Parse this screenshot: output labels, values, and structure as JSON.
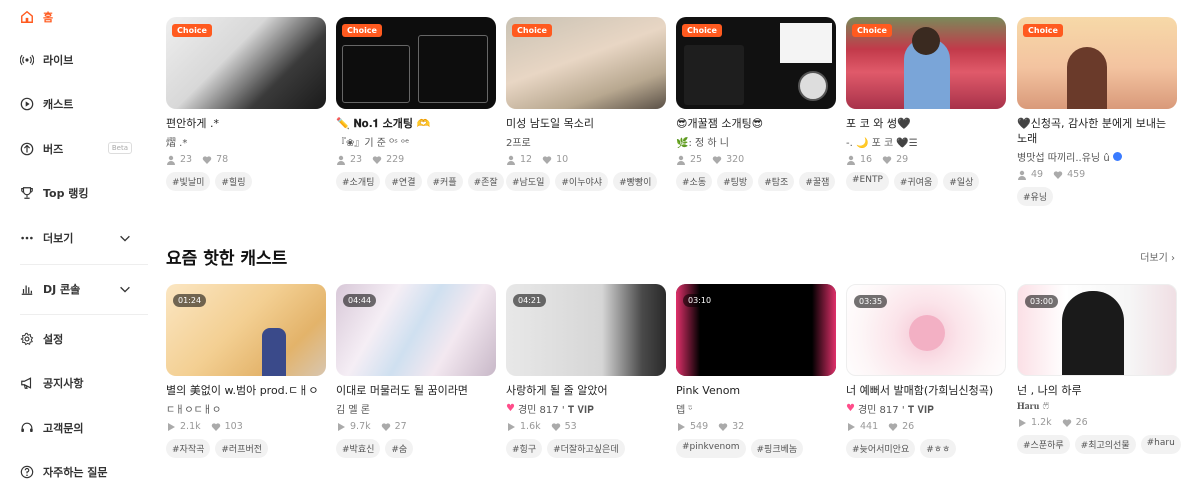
{
  "sidebar": {
    "items": [
      {
        "label": "홈",
        "icon": "home-icon"
      },
      {
        "label": "라이브",
        "icon": "live-icon"
      },
      {
        "label": "캐스트",
        "icon": "cast-icon"
      },
      {
        "label": "버즈",
        "icon": "buzz-icon",
        "badge": "Beta"
      },
      {
        "label": "Top 랭킹",
        "icon": "trophy-icon"
      },
      {
        "label": "더보기",
        "icon": "more-dots-icon"
      },
      {
        "label": "DJ 콘솔",
        "icon": "chart-icon"
      },
      {
        "label": "설정",
        "icon": "gear-icon"
      },
      {
        "label": "공지사항",
        "icon": "megaphone-icon"
      },
      {
        "label": "고객문의",
        "icon": "headset-icon"
      },
      {
        "label": "자주하는 질문",
        "icon": "question-icon"
      }
    ]
  },
  "colors": {
    "accent": "#ff5a1f",
    "pink": "#ff4d8a"
  },
  "top_row": [
    {
      "badge": "Choice",
      "title": "편안하게 .*",
      "author": "熠 .*",
      "listeners": "23",
      "likes": "78",
      "tags": [
        "#빛날미",
        "#힐링"
      ]
    },
    {
      "badge": "Choice",
      "title": "✏️ 𝐍𝐨.𝟏 소개팅 🫶",
      "author": "『❀』기 준 ᴼˢ ᵒᵉ",
      "listeners": "23",
      "likes": "229",
      "tags": [
        "#소개팅",
        "#연결",
        "#커플",
        "#존잘"
      ]
    },
    {
      "badge": "Choice",
      "title": "미성 남도일 목소리",
      "author": "2프로",
      "listeners": "12",
      "likes": "10",
      "tags": [
        "#남도일",
        "#이누야샤",
        "#빵빵이"
      ]
    },
    {
      "badge": "Choice",
      "title": "😎개꿀잼 소개팅😎",
      "author": "🌿: 정 하 니",
      "listeners": "25",
      "likes": "320",
      "tags": [
        "#소동",
        "#팅방",
        "#탐조",
        "#꿀잼"
      ]
    },
    {
      "badge": "Choice",
      "title": "포 코 와 썽🖤",
      "author": "-. 🌙 포 코 🖤☰",
      "listeners": "16",
      "likes": "29",
      "tags": [
        "#ENTP",
        "#귀여움",
        "#일상"
      ]
    },
    {
      "badge": "Choice",
      "title": "🖤신청곡, 감사한 분에게 보내는 노래",
      "author": "병맛섭 따끼리..유닝 û",
      "listeners": "49",
      "likes": "459",
      "tags": [
        "#유닝"
      ]
    }
  ],
  "section": {
    "title": "요즘 핫한 캐스트",
    "more": "더보기 ›"
  },
  "bottom_row": [
    {
      "duration": "01:24",
      "title": "별의 美없이 w.범아 prod.ㄷㅐㅇ",
      "author": "ㄷㅐㅇㄷㅐㅇ",
      "author_heart": false,
      "plays": "2.1k",
      "likes": "103",
      "tags": [
        "#자작곡",
        "#러프버전"
      ]
    },
    {
      "duration": "04:44",
      "title": "이대로 머물러도 될 꿈이라면",
      "author": "김 멜 론",
      "author_heart": false,
      "plays": "9.7k",
      "likes": "27",
      "tags": [
        "#박효신",
        "#숨"
      ]
    },
    {
      "duration": "04:21",
      "title": "사랑하게 될 줄 알았어",
      "author": "경민 817 ' 𝐓 𝐕𝐈𝐏",
      "author_heart": true,
      "plays": "1.6k",
      "likes": "53",
      "tags": [
        "#힝구",
        "#더잘하고싶은데"
      ]
    },
    {
      "duration": "03:10",
      "title": "Pink Venom",
      "author": "뎁 ᵕ̈",
      "author_heart": false,
      "plays": "549",
      "likes": "32",
      "tags": [
        "#pinkvenom",
        "#핑크베놈"
      ]
    },
    {
      "duration": "03:35",
      "title": "너 예뻐서 발매함(가희님신청곡)",
      "author": "경민 817 ' 𝐓 𝐕𝐈𝐏",
      "author_heart": true,
      "plays": "441",
      "likes": "26",
      "tags": [
        "#늦어서미안요",
        "#ㅎㅎ"
      ]
    },
    {
      "duration": "03:00",
      "title": "넌 , 나의 하루",
      "author": "𝐇𝐚𝐫𝐮 ෆ⃛",
      "author_heart": false,
      "plays": "1.2k",
      "likes": "26",
      "tags": [
        "#스푼하루",
        "#최고의선물",
        "#haru"
      ]
    }
  ]
}
